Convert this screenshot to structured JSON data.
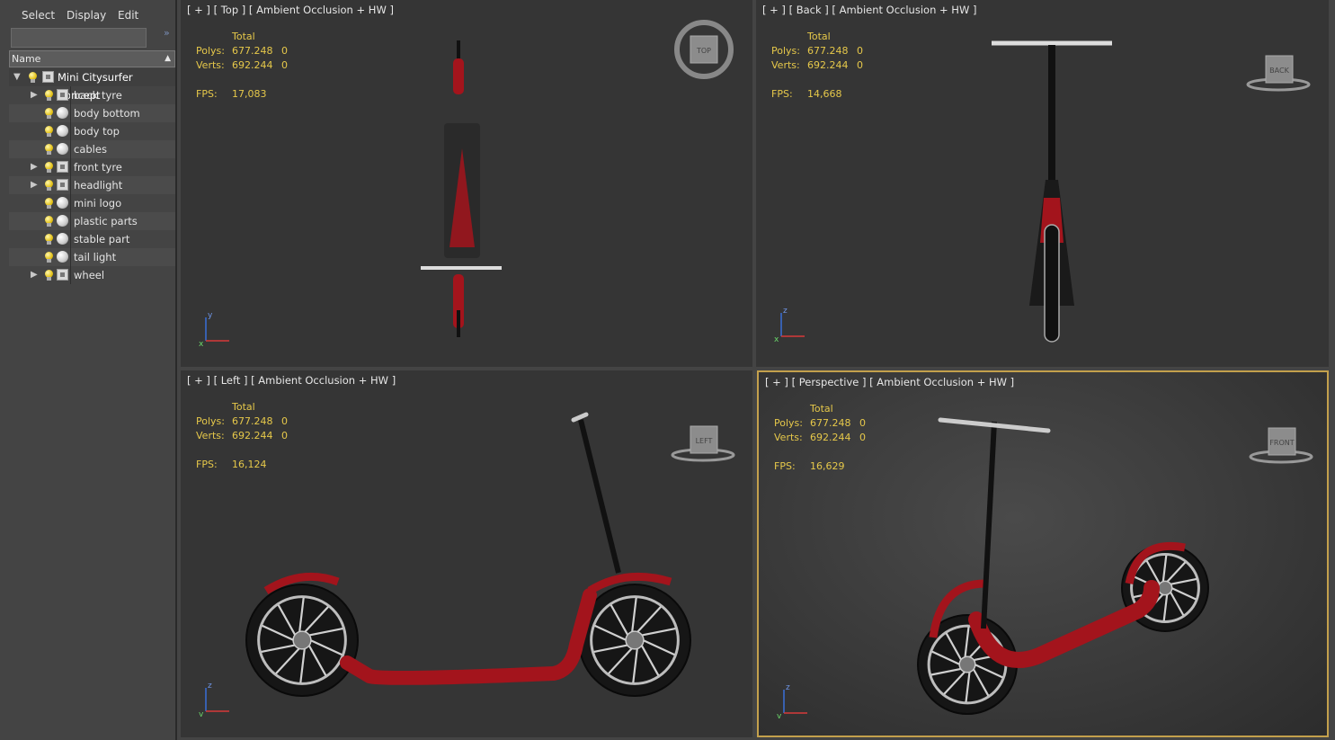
{
  "menu": {
    "select": "Select",
    "display": "Display",
    "edit": "Edit"
  },
  "collapse_glyph": "»",
  "column_header": {
    "name": "Name",
    "sort_icon": "▲"
  },
  "tree": {
    "root": "Mini Citysurfer Concept",
    "items": [
      {
        "label": "back tyre",
        "type": "group",
        "expandable": true
      },
      {
        "label": "body bottom",
        "type": "object",
        "expandable": false
      },
      {
        "label": "body top",
        "type": "object",
        "expandable": false
      },
      {
        "label": "cables",
        "type": "object",
        "expandable": false
      },
      {
        "label": "front tyre",
        "type": "group",
        "expandable": true
      },
      {
        "label": "headlight",
        "type": "group",
        "expandable": true
      },
      {
        "label": "mini logo",
        "type": "object",
        "expandable": false
      },
      {
        "label": "plastic parts",
        "type": "object",
        "expandable": false
      },
      {
        "label": "stable part",
        "type": "object",
        "expandable": false
      },
      {
        "label": "tail light",
        "type": "object",
        "expandable": false
      },
      {
        "label": "wheel",
        "type": "group",
        "expandable": true
      }
    ]
  },
  "stats_labels": {
    "total": "Total",
    "polys": "Polys:",
    "verts": "Verts:",
    "fps": "FPS:"
  },
  "viewports": [
    {
      "id": "top",
      "label": "[ + ] [ Top ] [ Ambient Occlusion + HW ]",
      "polys": "677.248",
      "polys_sel": "0",
      "verts": "692.244",
      "verts_sel": "0",
      "fps": "17,083",
      "cube_label": "TOP",
      "axes": [
        "y",
        "x"
      ]
    },
    {
      "id": "back",
      "label": "[ + ] [ Back ] [ Ambient Occlusion + HW ]",
      "polys": "677.248",
      "polys_sel": "0",
      "verts": "692.244",
      "verts_sel": "0",
      "fps": "14,668",
      "cube_label": "BACK",
      "axes": [
        "z",
        "x"
      ]
    },
    {
      "id": "left",
      "label": "[ + ] [ Left ] [ Ambient Occlusion + HW ]",
      "polys": "677.248",
      "polys_sel": "0",
      "verts": "692.244",
      "verts_sel": "0",
      "fps": "16,124",
      "cube_label": "LEFT",
      "axes": [
        "z",
        "y"
      ]
    },
    {
      "id": "persp",
      "label": "[ + ] [ Perspective ] [ Ambient Occlusion + HW ]",
      "polys": "677.248",
      "polys_sel": "0",
      "verts": "692.244",
      "verts_sel": "0",
      "fps": "16,629",
      "cube_label": "FRONT",
      "axes": [
        "z",
        "y"
      ]
    }
  ],
  "colors": {
    "accent_active_viewport": "#c3a04c",
    "stats_text": "#e6c84a",
    "scooter_red": "#a3141c"
  }
}
